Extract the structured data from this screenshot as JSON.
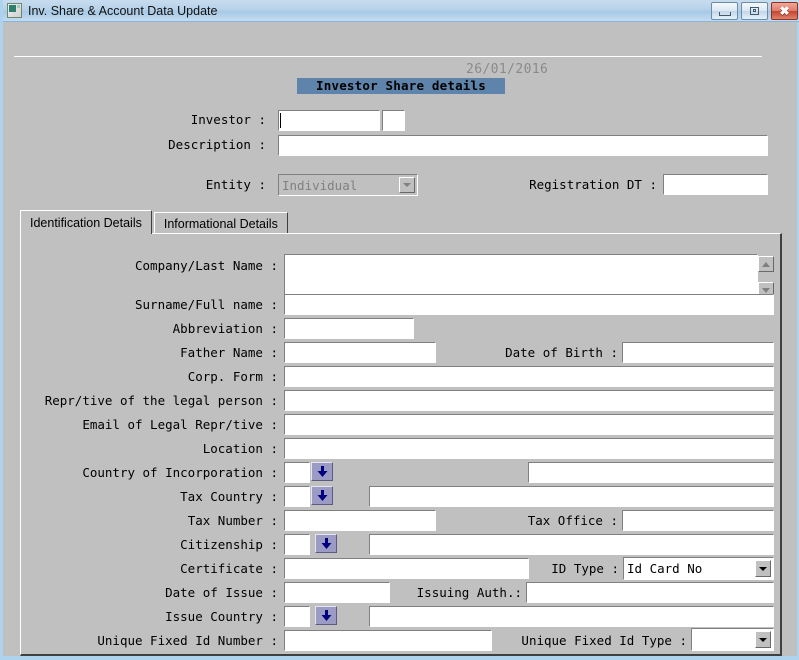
{
  "window": {
    "title": "Inv. Share & Account Data Update",
    "icon": "app-window-icon",
    "minimize_label": "Minimize",
    "maximize_label": "Maximize",
    "close_label": "Close"
  },
  "header": {
    "date": "26/01/2016",
    "section_title": "Investor Share details"
  },
  "top_form": {
    "investor_label": "Investor :",
    "investor_value": "",
    "investor_code_value": "",
    "description_label": "Description :",
    "description_value": "",
    "entity_label": "Entity :",
    "entity_value": "Individual",
    "entity_disabled": true,
    "registration_dt_label": "Registration DT :",
    "registration_dt_value": ""
  },
  "tabs": [
    {
      "label": "Identification Details",
      "active": true
    },
    {
      "label": "Informational Details",
      "active": false
    }
  ],
  "identification": {
    "company_last_name_label": "Company/Last Name :",
    "company_last_name_value": "",
    "surname_full_name_label": "Surname/Full name :",
    "surname_full_name_value": "",
    "abbreviation_label": "Abbreviation :",
    "abbreviation_value": "",
    "father_name_label": "Father Name :",
    "father_name_value": "",
    "date_of_birth_label": "Date of Birth :",
    "date_of_birth_value": "",
    "corp_form_label": "Corp. Form :",
    "corp_form_value": "",
    "repr_legal_person_label": "Repr/tive of the legal person :",
    "repr_legal_person_value": "",
    "email_legal_repr_label": "Email of Legal Repr/tive :",
    "email_legal_repr_value": "",
    "location_label": "Location :",
    "location_value": "",
    "country_incorporation_label": "Country of Incorporation :",
    "country_incorporation_code": "",
    "country_incorporation_name": "",
    "tax_country_label": "Tax Country :",
    "tax_country_code": "",
    "tax_country_name": "",
    "tax_number_label": "Tax Number :",
    "tax_number_value": "",
    "tax_office_label": "Tax Office :",
    "tax_office_value": "",
    "citizenship_label": "Citizenship :",
    "citizenship_code": "",
    "citizenship_name": "",
    "certificate_label": "Certificate :",
    "certificate_value": "",
    "id_type_label": "ID Type :",
    "id_type_value": "Id Card No",
    "date_of_issue_label": "Date of Issue :",
    "date_of_issue_value": "",
    "issuing_auth_label": "Issuing Auth.:",
    "issuing_auth_value": "",
    "issue_country_label": "Issue Country :",
    "issue_country_code": "",
    "issue_country_name": "",
    "unique_fixed_id_number_label": "Unique Fixed Id Number :",
    "unique_fixed_id_number_value": "",
    "unique_fixed_id_type_label": "Unique Fixed Id Type :",
    "unique_fixed_id_type_value": ""
  },
  "icons": {
    "lookup_arrow": "down-arrow-lookup-icon",
    "scroll_up": "scroll-up-icon",
    "scroll_down": "scroll-down-icon",
    "combo_arrow": "chevron-down-icon"
  },
  "colors": {
    "window_bg": "#c0c0c0",
    "title_bar": "#b7d2ea",
    "frame_blue": "#aed3ee",
    "section_title_bg": "#5f84ab",
    "lookup_button": "#9b9bc4",
    "lookup_arrow": "#000080",
    "date_text": "#8a8a8a",
    "disabled_text": "#808080"
  }
}
